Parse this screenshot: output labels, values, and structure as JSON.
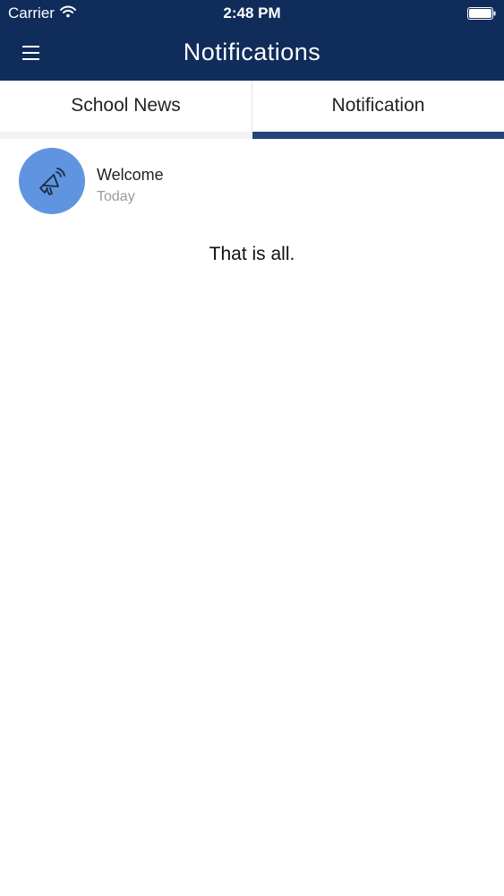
{
  "status_bar": {
    "carrier": "Carrier",
    "time": "2:48 PM"
  },
  "header": {
    "title": "Notifications",
    "menu_icon": "hamburger-menu-icon"
  },
  "tabs": [
    {
      "label": "School News",
      "selected": false
    },
    {
      "label": "Notification",
      "selected": true
    }
  ],
  "notifications": [
    {
      "title": "Welcome",
      "time": "Today",
      "icon": "megaphone-icon"
    }
  ],
  "end_message": "That is all.",
  "colors": {
    "header_bg": "#102c5a",
    "tab_indicator": "#23457a",
    "avatar_bg": "#6094e0",
    "secondary_text": "#9a9a9a"
  }
}
